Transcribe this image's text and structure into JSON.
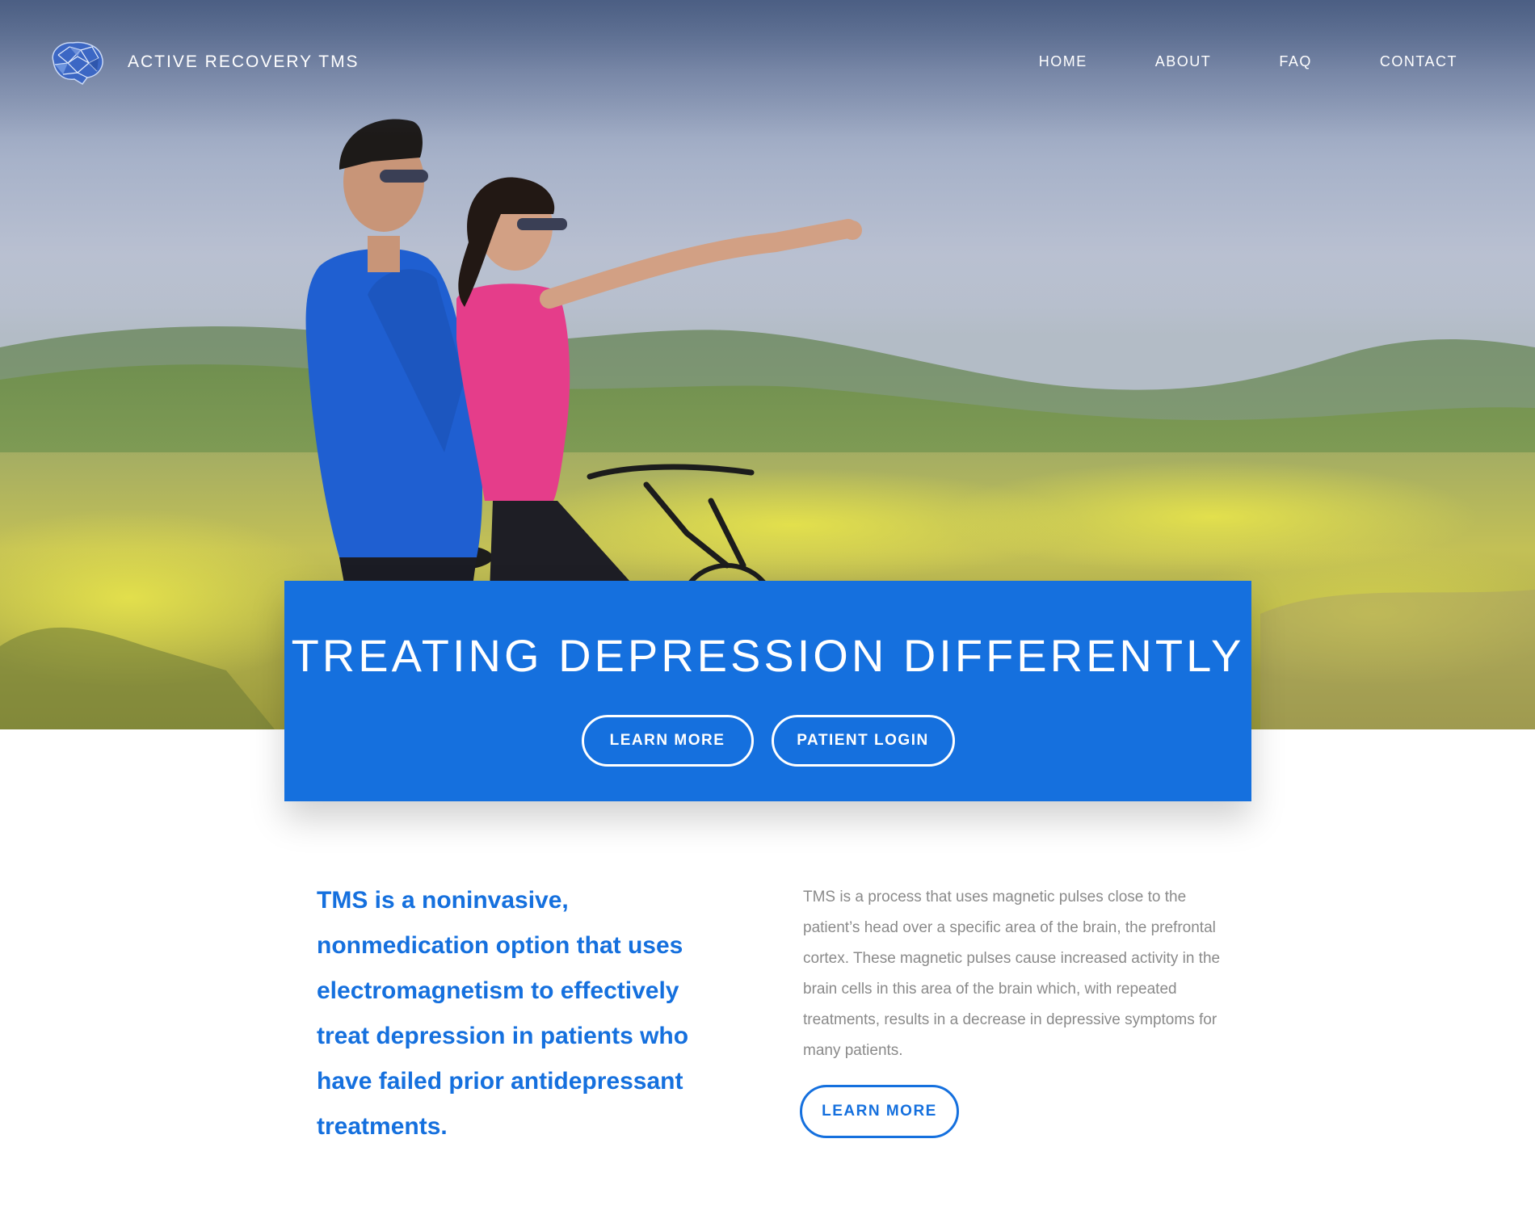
{
  "header": {
    "logo_text": "ACTIVE RECOVERY TMS",
    "logo_icon": "brain-icon",
    "nav": [
      {
        "label": "HOME"
      },
      {
        "label": "ABOUT"
      },
      {
        "label": "FAQ"
      },
      {
        "label": "CONTACT"
      }
    ]
  },
  "hero": {
    "title": "TREATING DEPRESSION DIFFERENTLY",
    "learn_more_label": "LEARN MORE",
    "patient_login_label": "PATIENT LOGIN"
  },
  "intro": {
    "lead": "TMS is a noninvasive, nonmedication option that uses electromagnetism to effectively treat depression in patients who have failed prior antidepressant treatments.",
    "body": "TMS is a process that uses magnetic pulses close to the patient’s head over a specific area of the brain, the prefrontal cortex. These magnetic pulses cause increased activity in the brain cells in this area of the brain which, with repeated treatments, results in a decrease in depressive symptoms for many patients.",
    "learn_more_label": "LEARN MORE"
  },
  "colors": {
    "brand_blue": "#1570de",
    "body_text": "#8a8a8a",
    "white": "#ffffff"
  }
}
